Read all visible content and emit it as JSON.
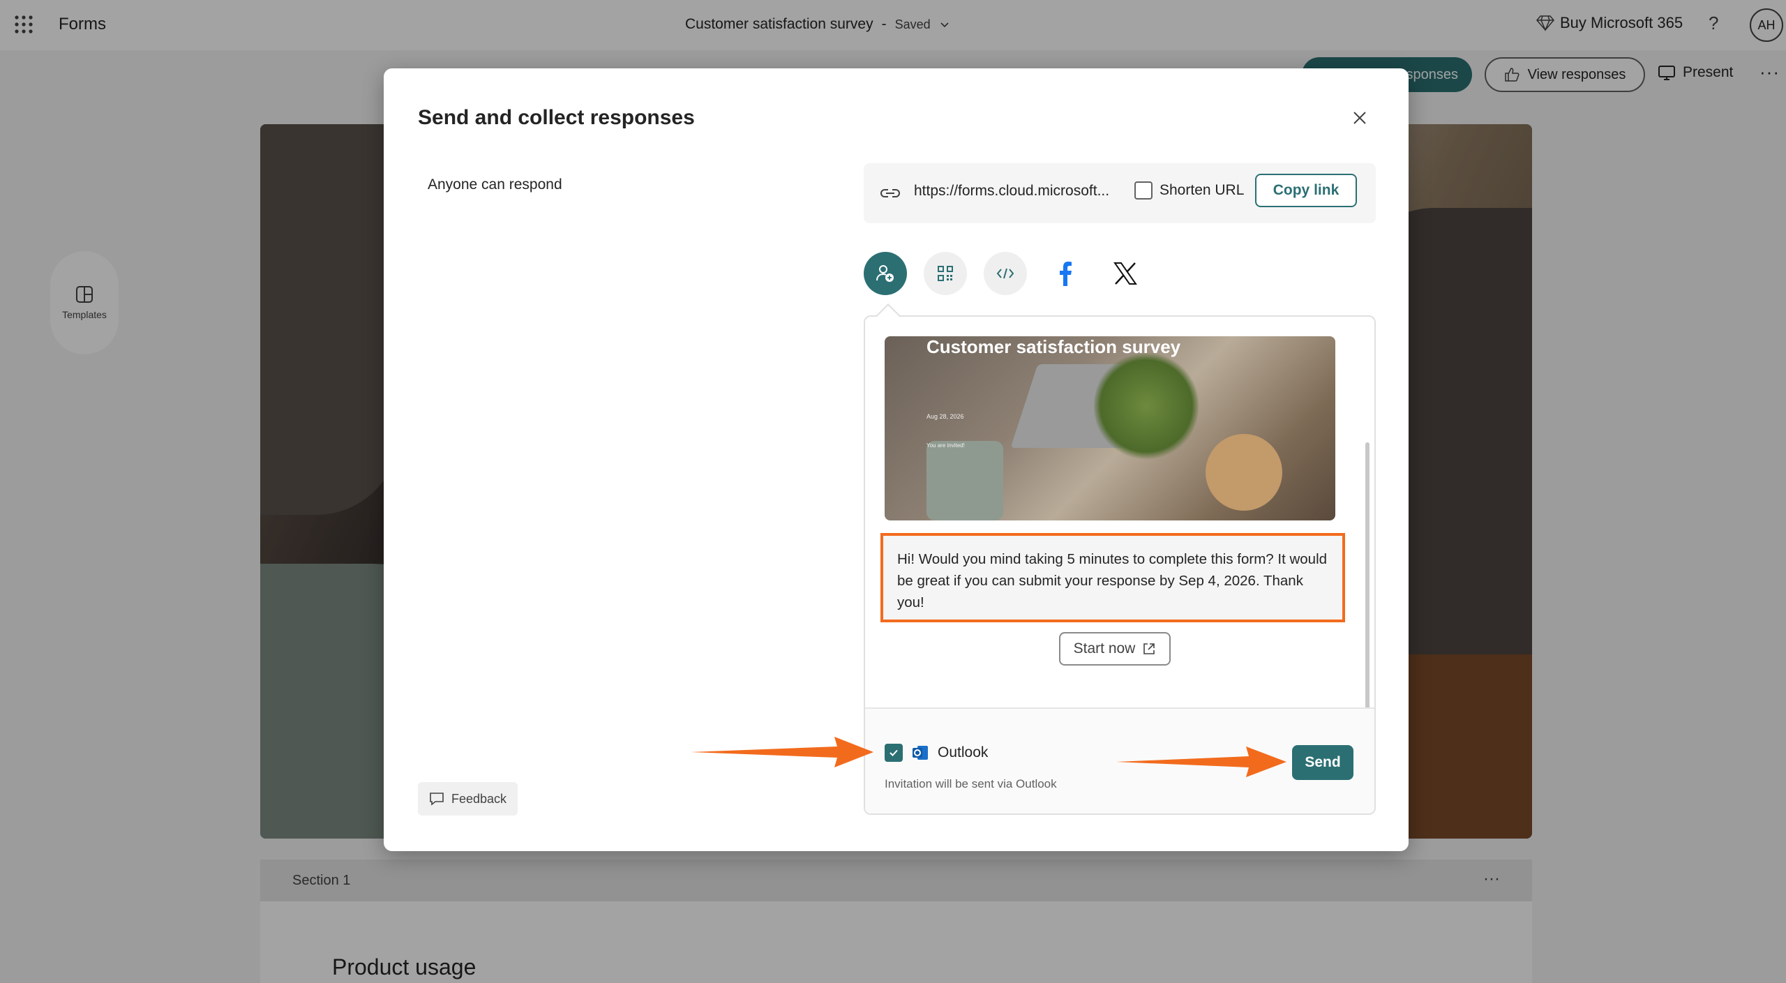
{
  "app": {
    "name": "Forms"
  },
  "header": {
    "doc_title": "Customer satisfaction survey",
    "separator": "-",
    "status": "Saved",
    "buy_label": "Buy Microsoft 365",
    "help_label": "?",
    "avatar_initials": "AH"
  },
  "commands": {
    "collect_label": "Collect responses",
    "collect_visible_label": "sponses",
    "view_label": "View responses",
    "present_label": "Present",
    "more_label": "···"
  },
  "rail": {
    "templates_label": "Templates"
  },
  "section": {
    "label": "Section 1",
    "more_label": "···",
    "question": "Product usage"
  },
  "dialog": {
    "title": "Send and collect responses",
    "audience": "Anyone can respond",
    "link": {
      "url": "https://forms.cloud.microsoft...",
      "shorten_label": "Shorten URL",
      "shorten_checked": false,
      "copy_label": "Copy link"
    },
    "share_icons": [
      "invite-people-icon",
      "qr-code-icon",
      "embed-code-icon",
      "facebook-icon",
      "x-icon"
    ],
    "preview": {
      "card_title": "Customer satisfaction survey",
      "card_date": "Aug 28, 2026",
      "card_invited": "You are invited!",
      "message": "Hi! Would you mind taking 5 minutes to complete this form? It would be great if you can submit your response by Sep 4, 2026. Thank you!",
      "start_label": "Start now"
    },
    "outlook": {
      "label": "Outlook",
      "checked": true,
      "subtext": "Invitation will be sent via Outlook"
    },
    "send_label": "Send",
    "feedback_label": "Feedback"
  },
  "colors": {
    "accent": "#2b6f73",
    "annotation": "#f26b1d"
  }
}
